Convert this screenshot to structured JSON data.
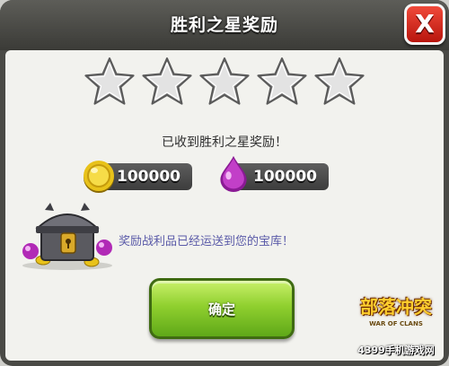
{
  "dialog": {
    "title": "胜利之星奖励",
    "close_label": "X",
    "received_text": "已收到胜利之星奖励！",
    "delivered_text": "奖励战利品已经运送到您的宝库！",
    "confirm_label": "确定"
  },
  "stars": {
    "total": 5,
    "earned": 0,
    "icon": "star-icon"
  },
  "rewards": [
    {
      "name": "gold",
      "value": "100000",
      "icon": "gold-coin-icon",
      "color": "#e8c21a"
    },
    {
      "name": "elixir",
      "value": "100000",
      "icon": "elixir-drop-icon",
      "color": "#b12ab6"
    }
  ],
  "loot_icon": "treasure-chest-icon",
  "watermark": {
    "title": "部落冲突",
    "subtitle": "WAR OF CLANS",
    "site": "4399手机游戏网"
  },
  "colors": {
    "confirm_green": "#90d02f",
    "close_red": "#d42a1c",
    "panel_bg": "#f2f2ee",
    "titlebar_bg": "#4a4a46"
  }
}
